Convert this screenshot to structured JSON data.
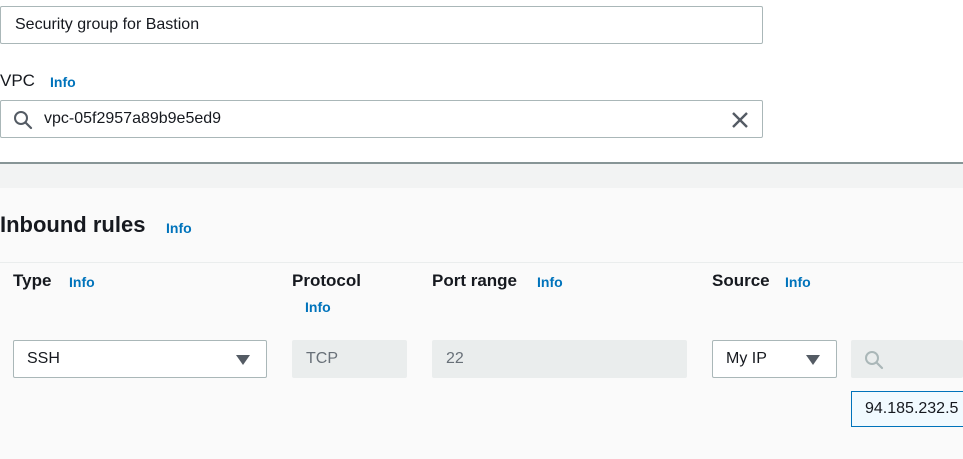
{
  "description_field": {
    "value": "Security group for Bastion"
  },
  "vpc": {
    "label": "VPC",
    "info": "Info",
    "value": "vpc-05f2957a89b9e5ed9"
  },
  "inbound": {
    "title": "Inbound rules",
    "info": "Info",
    "columns": {
      "type": {
        "label": "Type",
        "info": "Info"
      },
      "protocol": {
        "label": "Protocol",
        "info": "Info"
      },
      "port_range": {
        "label": "Port range",
        "info": "Info"
      },
      "source": {
        "label": "Source",
        "info": "Info"
      }
    },
    "rule": {
      "type": "SSH",
      "protocol": "TCP",
      "port_range": "22",
      "source_type": "My IP",
      "source_value": "94.185.232.5"
    }
  }
}
